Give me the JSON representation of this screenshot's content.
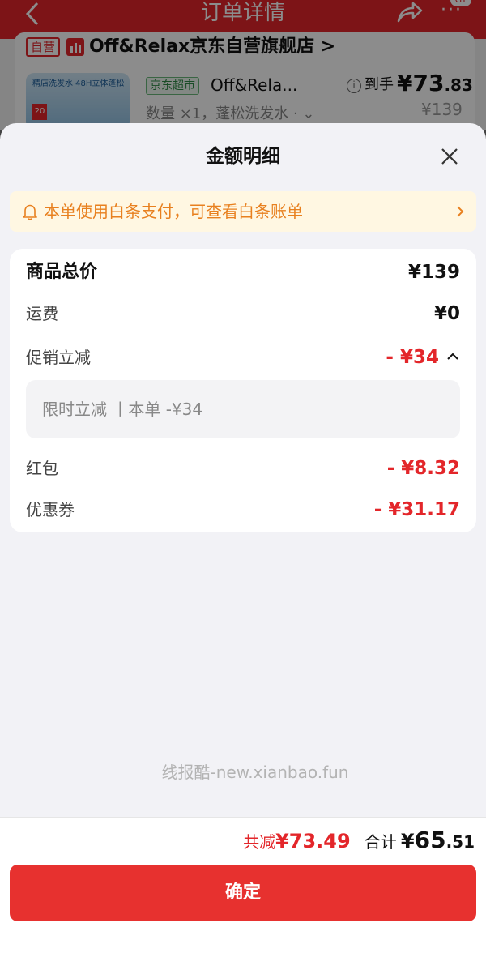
{
  "background_page": {
    "title": "订单详情",
    "more_glyph": "···",
    "badge": "GY",
    "self_operated_tag": "自营",
    "store_name": "Off&Relax京东自营旗舰店 >",
    "thumb_text": "精店洗发水 48H立体蓬松",
    "thumb_tag": "20",
    "supermarket_tag": "京东超市",
    "product_name": "Off&Rela...",
    "quantity_spec": "数量 ×1，蓬松洗发水 · ⌄",
    "arrive_label": "到手",
    "arrive_price_currency": "¥",
    "arrive_price_int": "73",
    "arrive_price_dec": ".83",
    "original_price": "¥139",
    "icons": {
      "back": "chevron-left-icon",
      "share": "share-icon",
      "more": "more-icon",
      "info": "info-icon"
    },
    "accent_color": "#e3262a"
  },
  "sheet": {
    "title": "金额明细",
    "close_icon": "close-icon",
    "notice": {
      "text": "本单使用白条支付，可查看白条账单",
      "icon": "bell-icon",
      "color": "#e8801f",
      "background": "#fff7e2"
    },
    "rows": {
      "goods_total": {
        "label": "商品总价",
        "value": "¥139"
      },
      "shipping": {
        "label": "运费",
        "value": "¥0"
      },
      "promotion": {
        "label": "促销立减",
        "value": "- ¥34",
        "expanded": true
      },
      "promotion_detail": "限时立减 丨本单 -¥34",
      "red_packet": {
        "label": "红包",
        "value": "- ¥8.32"
      },
      "coupon": {
        "label": "优惠券",
        "value": "- ¥31.17"
      }
    },
    "watermark": "线报酷-new.xianbao.fun",
    "footer": {
      "saved_label": "共减",
      "saved_value": "¥73.49",
      "sum_label": "合计",
      "sum_currency": "¥",
      "sum_int": "65",
      "sum_dec": ".51",
      "confirm_label": "确定"
    },
    "discount_color": "#e3262a"
  }
}
